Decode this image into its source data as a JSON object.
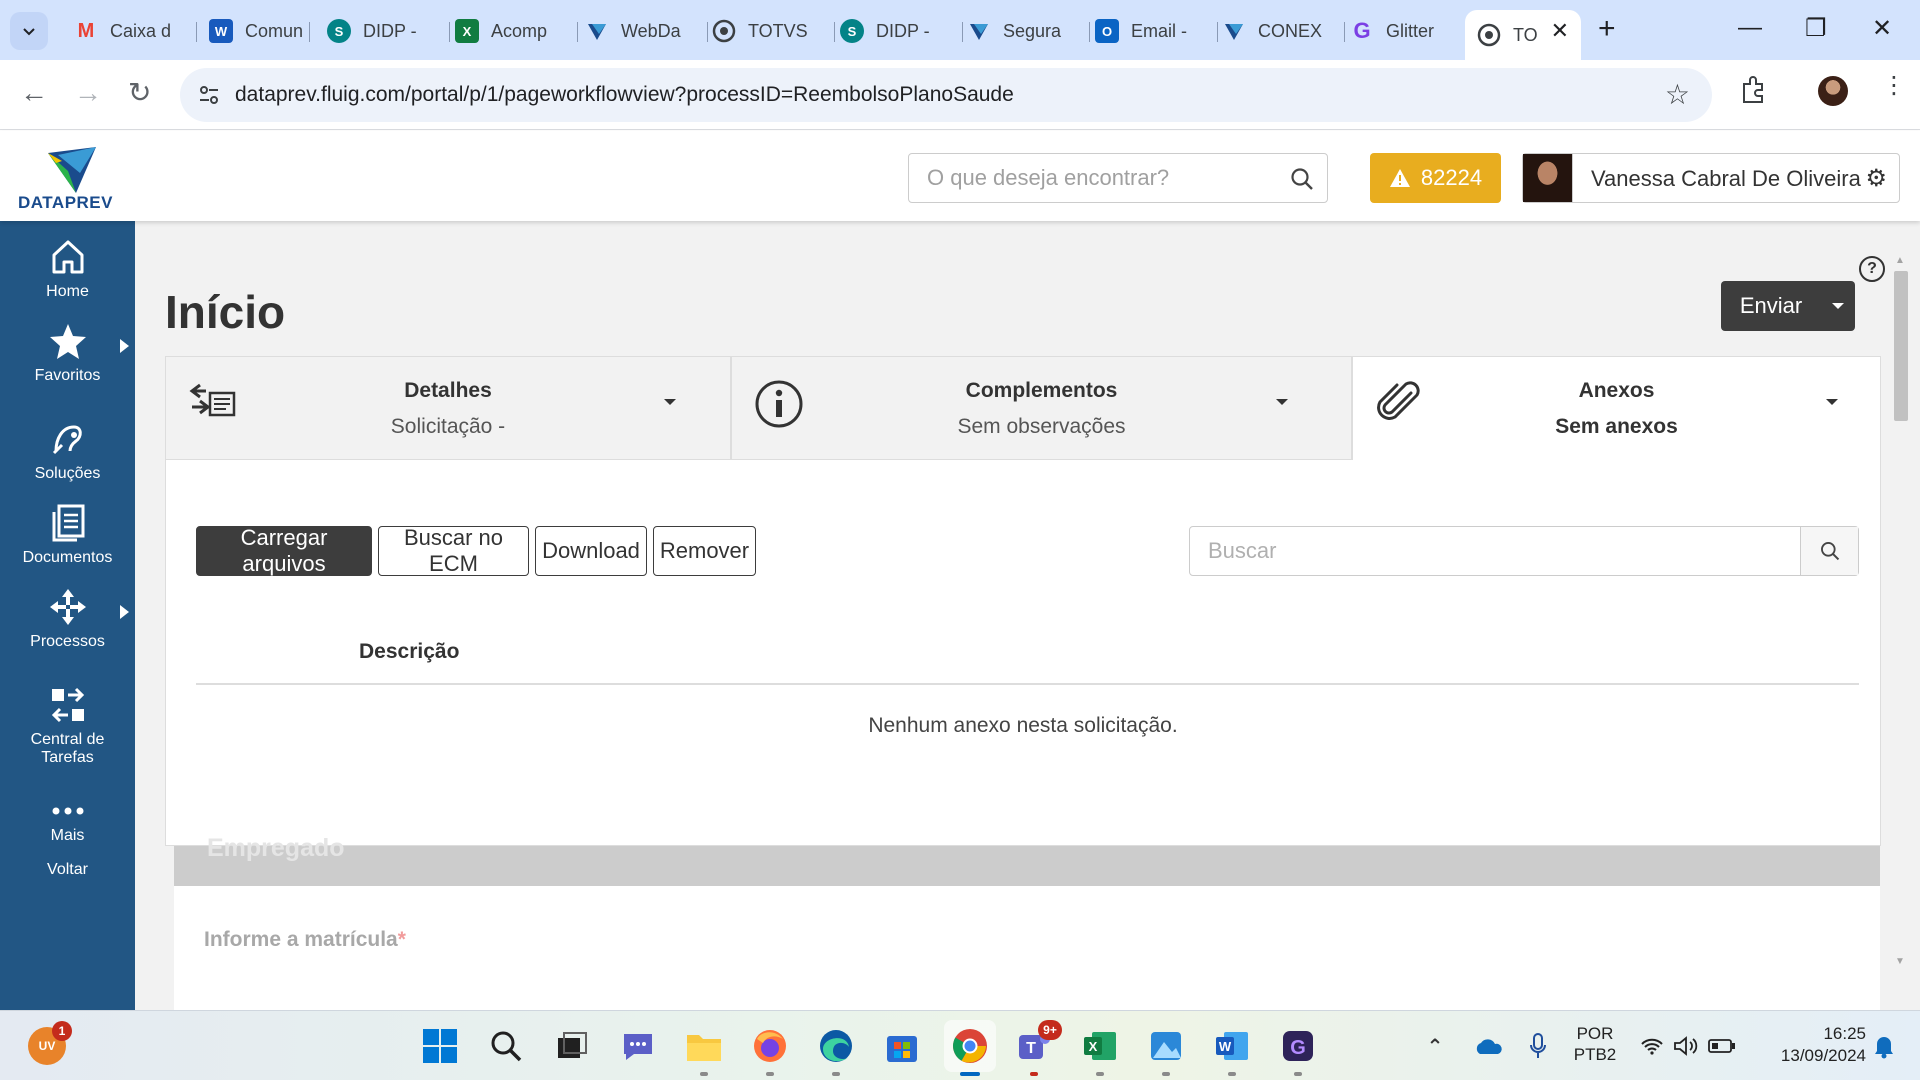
{
  "browser": {
    "tabs": [
      {
        "label": "Caixa d",
        "icon": "gmail-icon"
      },
      {
        "label": "Comun",
        "icon": "word-icon"
      },
      {
        "label": "DIDP -",
        "icon": "sharepoint-icon"
      },
      {
        "label": "Acomp",
        "icon": "excel-icon"
      },
      {
        "label": "WebDa",
        "icon": "dataprev-icon"
      },
      {
        "label": "TOTVS",
        "icon": "fluig-icon"
      },
      {
        "label": "DIDP -",
        "icon": "sharepoint-icon"
      },
      {
        "label": "Segura",
        "icon": "dataprev-icon"
      },
      {
        "label": "Email -",
        "icon": "outlook-icon"
      },
      {
        "label": "CONEX",
        "icon": "dataprev-icon"
      },
      {
        "label": "Glitter",
        "icon": "glitter-icon"
      },
      {
        "label": "TO",
        "icon": "fluig-icon",
        "active": true
      }
    ],
    "url": "dataprev.fluig.com/portal/p/1/pageworkflowview?processID=ReembolsoPlanoSaude"
  },
  "header": {
    "logo_text": "DATAPREV",
    "search_placeholder": "O que deseja encontrar?",
    "alert_count": "82224",
    "user_name": "Vanessa Cabral De Oliveira"
  },
  "sidebar": {
    "items": [
      {
        "label": "Home",
        "icon": "home-icon"
      },
      {
        "label": "Favoritos",
        "icon": "star-icon"
      },
      {
        "label": "Soluções",
        "icon": "solutions-icon"
      },
      {
        "label": "Documentos",
        "icon": "documents-icon"
      },
      {
        "label": "Processos",
        "icon": "processes-icon"
      },
      {
        "label": "Central de Tarefas",
        "icon": "tasks-icon"
      },
      {
        "label": "Mais",
        "icon": "more-icon"
      },
      {
        "label": "Voltar"
      }
    ]
  },
  "page": {
    "title": "Início",
    "send_label": "Enviar",
    "tabs": [
      {
        "title": "Detalhes",
        "subtitle": "Solicitação -",
        "icon": "details-icon"
      },
      {
        "title": "Complementos",
        "subtitle": "Sem observações",
        "icon": "info-icon"
      },
      {
        "title": "Anexos",
        "subtitle": "Sem anexos",
        "icon": "paperclip-icon"
      }
    ],
    "attachments": {
      "buttons": {
        "upload": "Carregar arquivos",
        "ecm": "Buscar no ECM",
        "download": "Download",
        "remove": "Remover"
      },
      "search_placeholder": "Buscar",
      "column_description": "Descrição",
      "empty_message": "Nenhum anexo nesta solicitação."
    },
    "section_title": "Empregado",
    "field_label": "Informe a matrícula",
    "required_mark": "*"
  },
  "taskbar": {
    "notification_count": "1",
    "teams_badge": "9+",
    "language": "POR",
    "layout": "PTB2",
    "time": "16:25",
    "date": "13/09/2024"
  },
  "colors": {
    "sidebar": "#225684",
    "alert": "#e8ad1f",
    "dark_button": "#3d3d3d"
  }
}
